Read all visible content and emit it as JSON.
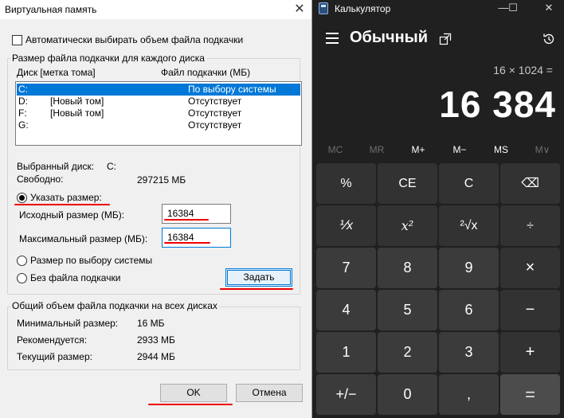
{
  "vm": {
    "title": "Виртуальная память",
    "close": "✕",
    "auto_label": "Автоматически выбирать объем файла подкачки",
    "group_label": "Размер файла подкачки для каждого диска",
    "col_disk": "Диск [метка тома]",
    "col_file": "Файл подкачки (МБ)",
    "drives": [
      {
        "letter": "C:",
        "label": "",
        "value": "По выбору системы",
        "selected": true
      },
      {
        "letter": "D:",
        "label": "[Новый том]",
        "value": "Отсутствует"
      },
      {
        "letter": "F:",
        "label": "[Новый том]",
        "value": "Отсутствует"
      },
      {
        "letter": "G:",
        "label": "",
        "value": "Отсутствует"
      }
    ],
    "selected_drive_label": "Выбранный диск:",
    "selected_drive_value": "C:",
    "free_label": "Свободно:",
    "free_value": "297215 МБ",
    "radio_custom": "Указать размер:",
    "initial_label": "Исходный размер (МБ):",
    "initial_value": "16384",
    "max_label": "Максимальный размер (МБ):",
    "max_value": "16384",
    "radio_system": "Размер по выбору системы",
    "radio_none": "Без файла подкачки",
    "set_button": "Задать",
    "total_group_label": "Общий объем файла подкачки на всех дисках",
    "min_label": "Минимальный размер:",
    "min_value": "16 МБ",
    "recommended_label": "Рекомендуется:",
    "recommended_value": "2933 МБ",
    "current_label": "Текущий размер:",
    "current_value": "2944 МБ",
    "ok_button": "OK",
    "cancel_button": "Отмена"
  },
  "calc": {
    "title": "Калькулятор",
    "minimize": "—",
    "maximize": "☐",
    "close": "✕",
    "mode": "Обычный",
    "expression": "16 × 1024 =",
    "result": "16 384",
    "memory": [
      "MC",
      "MR",
      "M+",
      "M−",
      "MS",
      "M∨"
    ],
    "keys": [
      "%",
      "CE",
      "C",
      "⌫",
      "⅟x",
      "x²",
      "²√x",
      "÷",
      "7",
      "8",
      "9",
      "×",
      "4",
      "5",
      "6",
      "−",
      "1",
      "2",
      "3",
      "+",
      "+/−",
      "0",
      ",",
      "="
    ]
  },
  "colors": {
    "accent": "#0078d7",
    "annotation": "#ee0000",
    "calc_bg": "#202020"
  }
}
